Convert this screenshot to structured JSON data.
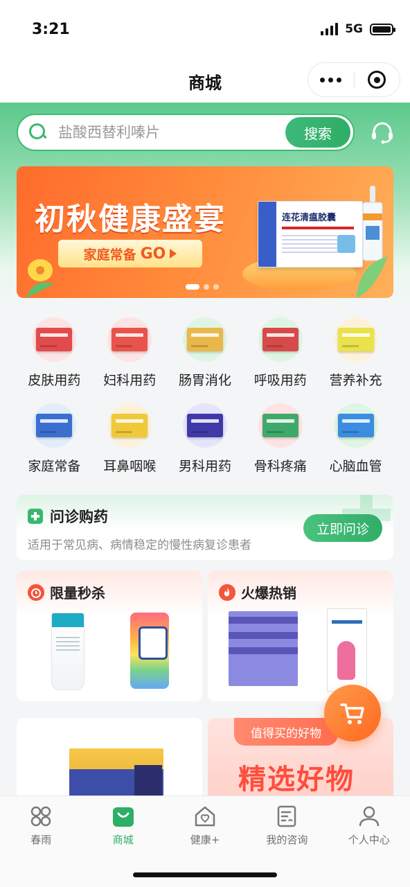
{
  "status_bar": {
    "time": "3:21",
    "network": "5G"
  },
  "nav": {
    "title": "商城"
  },
  "search": {
    "placeholder": "盐酸西替利嗪片",
    "button_label": "搜索"
  },
  "banner": {
    "title": "初秋健康盛宴",
    "cta_label": "家庭常备",
    "cta_go": "GO",
    "product_name": "连花清瘟胶囊",
    "slides": 3,
    "active_slide": 1
  },
  "categories": [
    {
      "label": "皮肤用药",
      "color": "#fde3e3",
      "pack": "#e24b4b"
    },
    {
      "label": "妇科用药",
      "color": "#fde3e3",
      "pack": "#e8534a"
    },
    {
      "label": "肠胃消化",
      "color": "#dff5e4",
      "pack": "#e9b84a"
    },
    {
      "label": "呼吸用药",
      "color": "#dff5e4",
      "pack": "#d84a4a"
    },
    {
      "label": "营养补充",
      "color": "#fdf2d9",
      "pack": "#e9e24b"
    },
    {
      "label": "家庭常备",
      "color": "#e2ecfb",
      "pack": "#3a6fd1"
    },
    {
      "label": "耳鼻咽喉",
      "color": "#fdf2d9",
      "pack": "#f0c93b"
    },
    {
      "label": "男科用药",
      "color": "#e6e4fb",
      "pack": "#3f3aa8"
    },
    {
      "label": "骨科疼痛",
      "color": "#fde3e3",
      "pack": "#3fa96a"
    },
    {
      "label": "心脑血管",
      "color": "#dff5e4",
      "pack": "#3a8de0"
    }
  ],
  "consult": {
    "title": "问诊购药",
    "description": "适用于常见病、病情稳定的慢性病复诊患者",
    "button_label": "立即问诊"
  },
  "promos": {
    "flash_sale": {
      "title": "限量秒杀"
    },
    "hot_sale": {
      "title": "火爆热销"
    }
  },
  "selection": {
    "tag": "值得买的好物",
    "title": "精选好物"
  },
  "tabs": [
    {
      "label": "春雨",
      "icon": "grid-icon",
      "active": false
    },
    {
      "label": "商城",
      "icon": "shopping-bag-icon",
      "active": true
    },
    {
      "label": "健康+",
      "icon": "health-house-icon",
      "active": false
    },
    {
      "label": "我的咨询",
      "icon": "consult-document-icon",
      "active": false
    },
    {
      "label": "个人中心",
      "icon": "person-icon",
      "active": false
    }
  ],
  "colors": {
    "brand_green": "#2fae66",
    "accent_orange": "#ff6a1f",
    "promo_red": "#ff4d3c"
  }
}
